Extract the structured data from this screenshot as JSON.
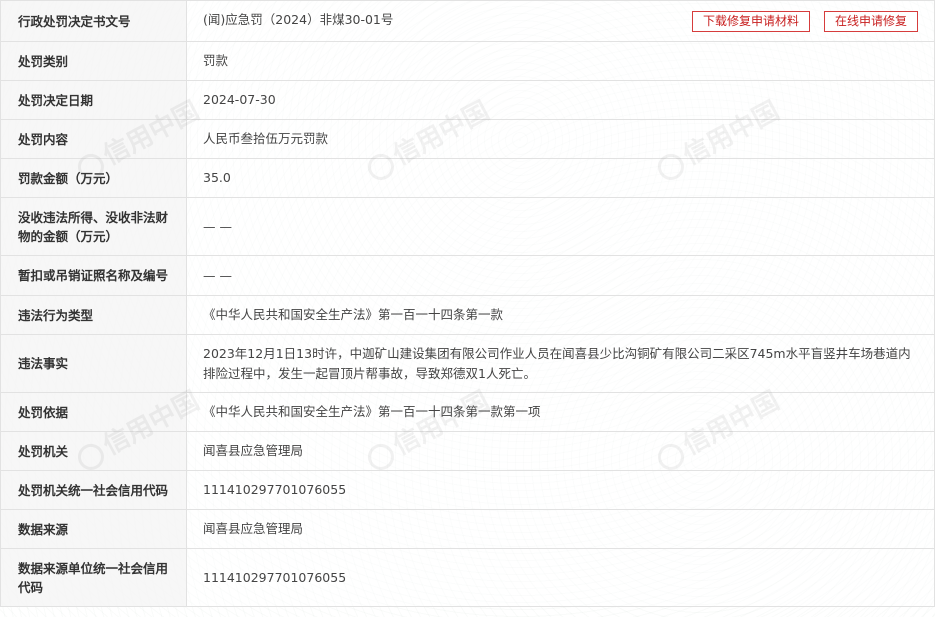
{
  "actions": {
    "download_label": "下载修复申请材料",
    "online_label": "在线申请修复"
  },
  "watermark": {
    "text": "信用中国"
  },
  "rows": [
    {
      "label": "行政处罚决定书文号",
      "value": "(闻)应急罚（2024）非煤30-01号"
    },
    {
      "label": "处罚类别",
      "value": "罚款"
    },
    {
      "label": "处罚决定日期",
      "value": "2024-07-30"
    },
    {
      "label": "处罚内容",
      "value": "人民币叁拾伍万元罚款"
    },
    {
      "label": "罚款金额（万元）",
      "value": "35.0"
    },
    {
      "label": "没收违法所得、没收非法财物的金额（万元）",
      "value": "— —"
    },
    {
      "label": "暂扣或吊销证照名称及编号",
      "value": "— —"
    },
    {
      "label": "违法行为类型",
      "value": "《中华人民共和国安全生产法》第一百一十四条第一款"
    },
    {
      "label": "违法事实",
      "value": "2023年12月1日13时许，中迦矿山建设集团有限公司作业人员在闻喜县少比沟铜矿有限公司二采区745m水平盲竖井车场巷道内排险过程中，发生一起冒顶片帮事故，导致郑德双1人死亡。"
    },
    {
      "label": "处罚依据",
      "value": "《中华人民共和国安全生产法》第一百一十四条第一款第一项"
    },
    {
      "label": "处罚机关",
      "value": "闻喜县应急管理局"
    },
    {
      "label": "处罚机关统一社会信用代码",
      "value": "11141029770107605​5"
    },
    {
      "label": "数据来源",
      "value": "闻喜县应急管理局"
    },
    {
      "label": "数据来源单位统一社会信用代码",
      "value": "111410297701076055"
    }
  ]
}
